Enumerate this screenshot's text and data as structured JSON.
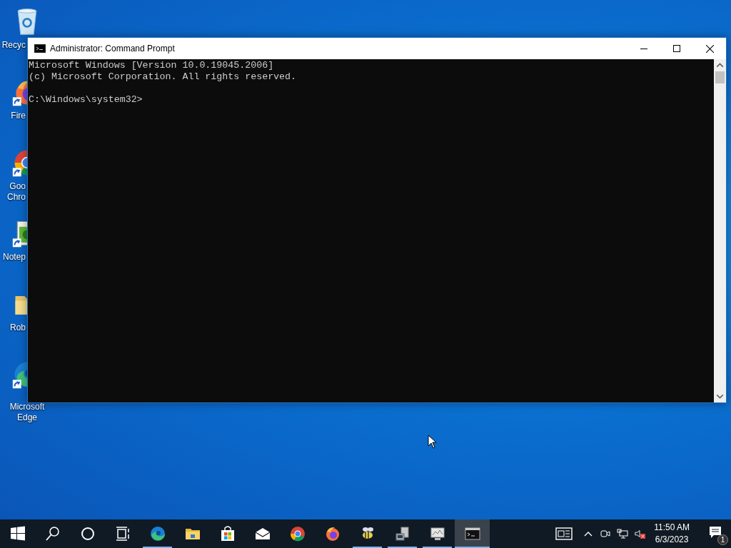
{
  "desktop_icons": [
    {
      "kind": "recycle-bin",
      "shortcut": false,
      "lines": [
        "Recyc"
      ]
    },
    {
      "kind": "firefox",
      "shortcut": true,
      "lines": [
        "Fire"
      ]
    },
    {
      "kind": "chrome",
      "shortcut": true,
      "lines": [
        "Goo",
        "Chro"
      ]
    },
    {
      "kind": "notepad",
      "shortcut": true,
      "lines": [
        "Notep"
      ]
    },
    {
      "kind": "folder",
      "shortcut": false,
      "lines": [
        "Rob"
      ]
    },
    {
      "kind": "edge",
      "shortcut": true,
      "lines": [
        "Microsoft",
        "Edge"
      ]
    }
  ],
  "window": {
    "title": "Administrator: Command Prompt",
    "console": {
      "lines": [
        "Microsoft Windows [Version 10.0.19045.2006]",
        "(c) Microsoft Corporation. All rights reserved."
      ],
      "prompt": "C:\\Windows\\system32>"
    }
  },
  "taskbar": {
    "apps": [
      {
        "kind": "start",
        "running": false,
        "selected": false
      },
      {
        "kind": "search",
        "running": false,
        "selected": false
      },
      {
        "kind": "cortana",
        "running": false,
        "selected": false
      },
      {
        "kind": "task-view",
        "running": false,
        "selected": false
      },
      {
        "kind": "edge",
        "running": true,
        "selected": false
      },
      {
        "kind": "explorer",
        "running": false,
        "selected": false
      },
      {
        "kind": "store",
        "running": false,
        "selected": false
      },
      {
        "kind": "mail",
        "running": false,
        "selected": false
      },
      {
        "kind": "chrome",
        "running": false,
        "selected": false
      },
      {
        "kind": "firefox",
        "running": false,
        "selected": false
      },
      {
        "kind": "bee",
        "running": true,
        "selected": false
      },
      {
        "kind": "computer",
        "running": true,
        "selected": false
      },
      {
        "kind": "monitor",
        "running": true,
        "selected": false
      },
      {
        "kind": "cmd",
        "running": true,
        "selected": true
      }
    ],
    "tray": {
      "muted": true,
      "time": "11:50 AM",
      "date": "6/3/2023",
      "notifications": "1"
    }
  }
}
